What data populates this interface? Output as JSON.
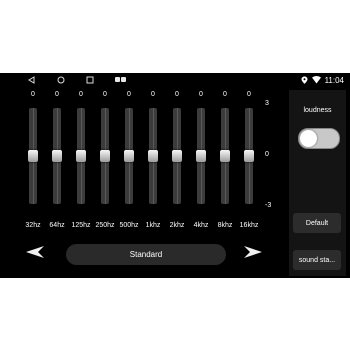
{
  "status": {
    "time": "11:04"
  },
  "equalizer": {
    "max_label": "3",
    "mid_label": "0",
    "min_label": "-3",
    "bands": [
      {
        "label": "32hz",
        "gain": "0"
      },
      {
        "label": "64hz",
        "gain": "0"
      },
      {
        "label": "125hz",
        "gain": "0"
      },
      {
        "label": "250hz",
        "gain": "0"
      },
      {
        "label": "500hz",
        "gain": "0"
      },
      {
        "label": "1khz",
        "gain": "0"
      },
      {
        "label": "2khz",
        "gain": "0"
      },
      {
        "label": "4khz",
        "gain": "0"
      },
      {
        "label": "8khz",
        "gain": "0"
      },
      {
        "label": "16khz",
        "gain": "0"
      }
    ]
  },
  "preset": {
    "name": "Standard"
  },
  "side": {
    "loudness_label": "loudness",
    "loudness_on": false,
    "default_label": "Default",
    "sound_stage_label": "sound sta..."
  },
  "colors": {
    "background": "#000000",
    "panel": "#141414",
    "track": "#3c3c3c"
  }
}
